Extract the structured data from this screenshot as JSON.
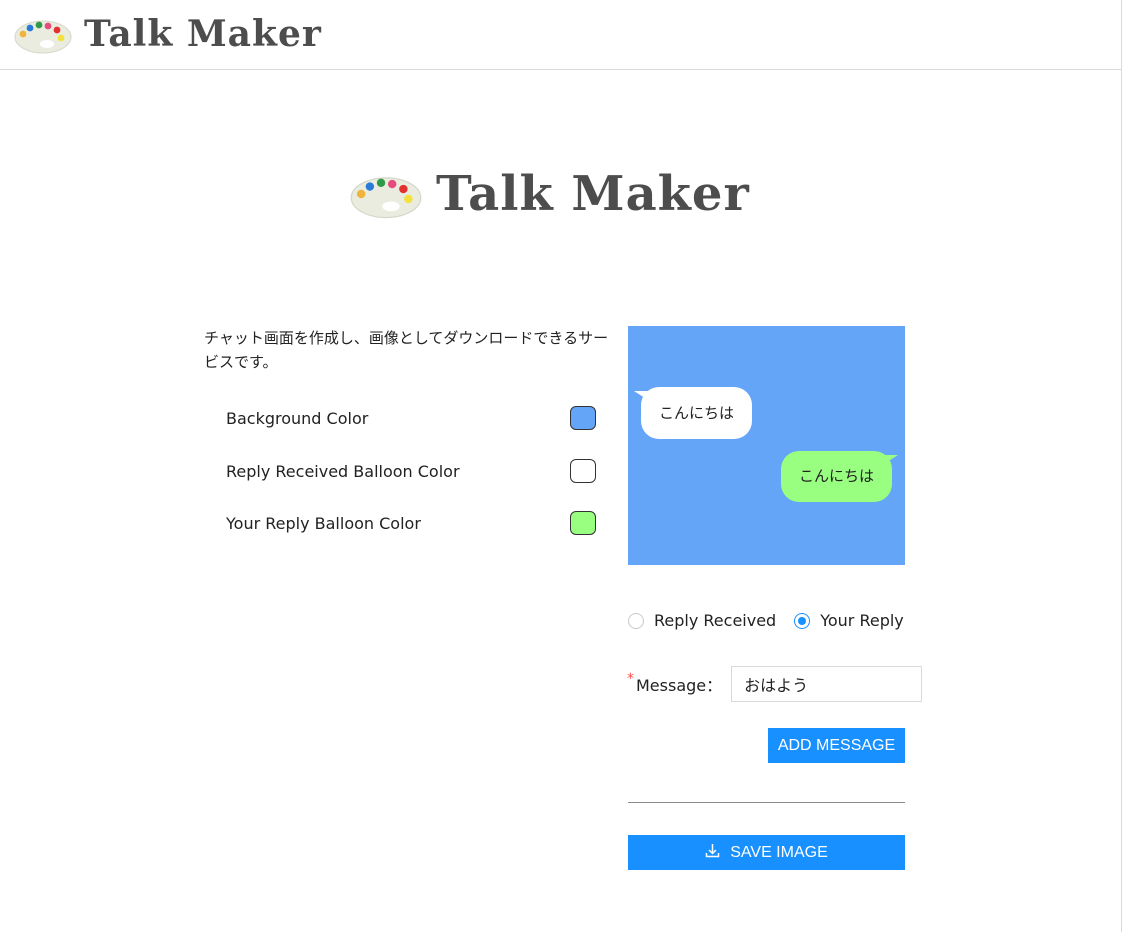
{
  "header": {
    "logo_text": "Talk Maker"
  },
  "hero": {
    "logo_text": "Talk Maker"
  },
  "description": "チャット画面を作成し、画像としてダウンロードできるサービスです。",
  "color_settings": [
    {
      "label": "Background Color",
      "color": "#64a5f8"
    },
    {
      "label": "Reply Received Balloon Color",
      "color": "#ffffff"
    },
    {
      "label": "Your Reply Balloon Color",
      "color": "#99ff80"
    }
  ],
  "preview": {
    "background_color": "#64a5f8",
    "messages": [
      {
        "side": "received",
        "text": "こんにちは",
        "color": "#ffffff"
      },
      {
        "side": "mine",
        "text": "こんにちは",
        "color": "#99ff80"
      }
    ]
  },
  "reply_type": {
    "options": [
      "Reply Received",
      "Your Reply"
    ],
    "selected": "Your Reply"
  },
  "message_field": {
    "label": "Message",
    "value": "おはよう"
  },
  "buttons": {
    "add_message": "ADD MESSAGE",
    "save_image": "SAVE IMAGE"
  },
  "accent_color": "#1890ff",
  "icons": {
    "logo": "palette-icon",
    "save": "download-icon"
  }
}
